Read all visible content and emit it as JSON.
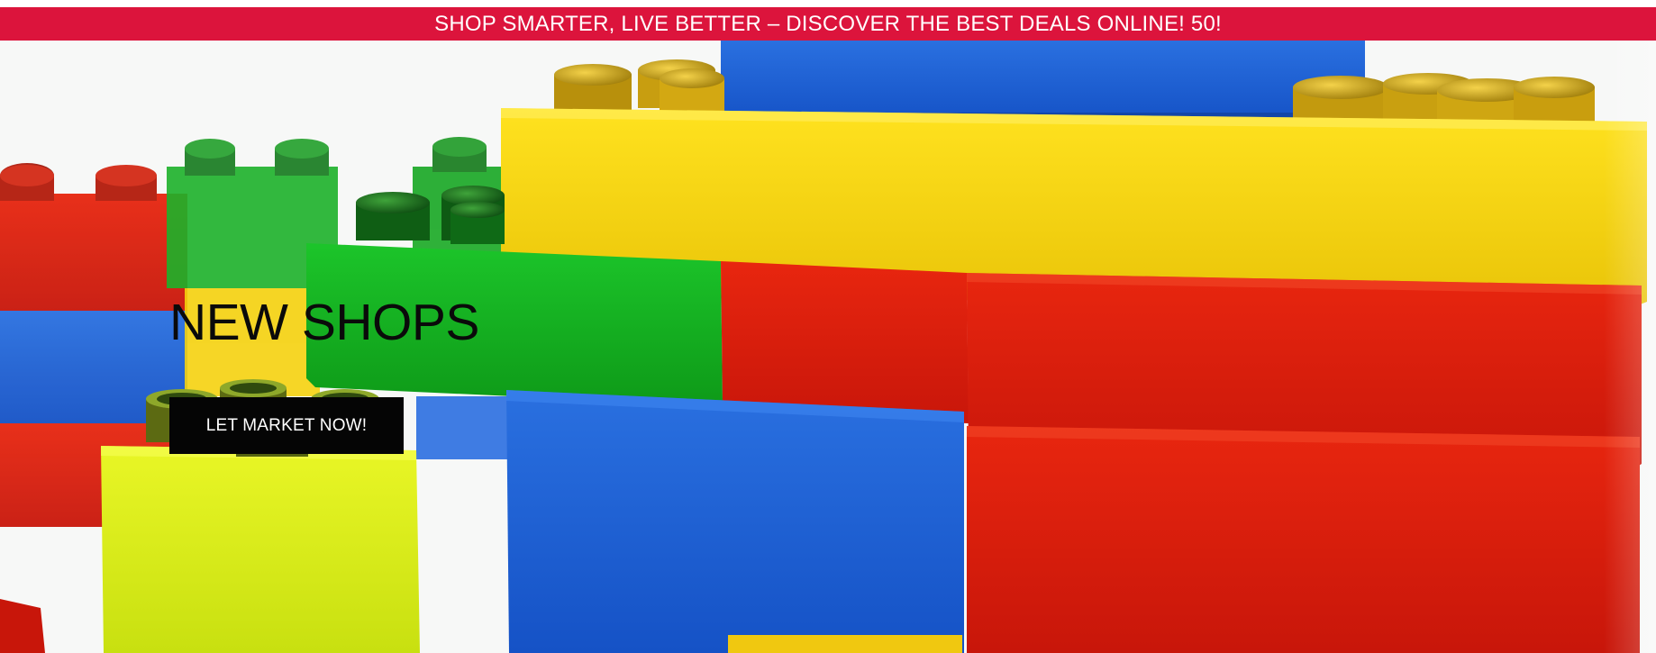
{
  "announcement": {
    "text": "SHOP SMARTER, LIVE BETTER – DISCOVER THE BEST DEALS ONLINE! 50!"
  },
  "hero": {
    "title": "NEW SHOPS",
    "cta_label": "LET MARKET NOW!",
    "image": "colorful-toy-building-blocks"
  },
  "colors": {
    "announcement_bg": "#DC143C",
    "announcement_text": "#FFFFFF",
    "cta_bg": "#050505",
    "cta_text": "#FFFFFF",
    "title_text": "#0A0A0A",
    "brick_yellow": "#F2D11A",
    "brick_red": "#D81E0E",
    "brick_blue": "#1F63D6",
    "brick_green": "#15B020",
    "brick_lime": "#D9EE1A"
  }
}
